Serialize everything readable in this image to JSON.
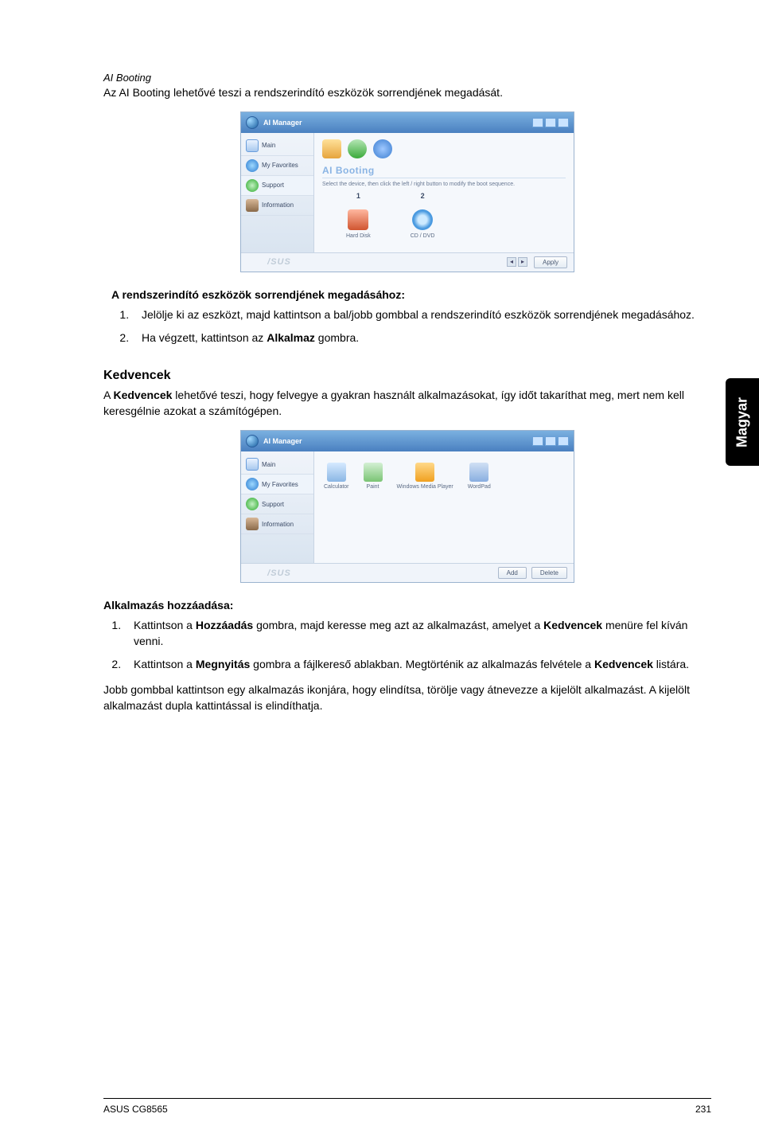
{
  "sidebar_lang": "Magyar",
  "ai_booting": {
    "heading": "AI Booting",
    "intro": "Az AI Booting lehetővé teszi a rendszerindító eszközök sorrendjének megadását."
  },
  "screenshot1": {
    "window_title": "AI Manager",
    "side": {
      "main": "Main",
      "fav": "My Favorites",
      "support": "Support",
      "info": "Information"
    },
    "sub_heading": "AI Booting",
    "hint": "Select the device, then click the left / right button to modify the boot sequence.",
    "col1_num": "1",
    "col1_label": "Hard Disk",
    "col2_num": "2",
    "col2_label": "CD / DVD",
    "apply_btn": "Apply",
    "logo": "/SUS"
  },
  "steps1": {
    "title": "A rendszerindító eszközök sorrendjének megadásához:",
    "s1": "Jelölje ki az eszközt, majd kattintson a bal/jobb gombbal a rendszerindító eszközök sorrendjének megadásához.",
    "s2_pre": "Ha végzett, kattintson az ",
    "s2_bold": "Alkalmaz",
    "s2_post": " gombra."
  },
  "kedvencek": {
    "heading": "Kedvencek",
    "para_pre": "A ",
    "para_bold": "Kedvencek",
    "para_post": " lehetővé teszi, hogy felvegye a gyakran használt alkalmazásokat, így időt takaríthat meg, mert nem kell keresgélnie azokat a számítógépen."
  },
  "screenshot2": {
    "window_title": "AI Manager",
    "side": {
      "main": "Main",
      "fav": "My Favorites",
      "support": "Support",
      "info": "Information"
    },
    "apps": {
      "a1": "Calculator",
      "a2": "Paint",
      "a3": "Windows Media Player",
      "a4": "WordPad"
    },
    "btn_add": "Add",
    "btn_delete": "Delete",
    "logo": "/SUS"
  },
  "steps2": {
    "title": "Alkalmazás hozzáadása:",
    "s1_a": "Kattintson a ",
    "s1_b": "Hozzáadás",
    "s1_c": " gombra, majd keresse meg azt az alkalmazást, amelyet a ",
    "s1_d": "Kedvencek",
    "s1_e": " menüre fel kíván venni.",
    "s2_a": "Kattintson a ",
    "s2_b": "Megnyitás",
    "s2_c": " gombra a fájlkereső ablakban. Megtörténik az alkalmazás felvétele a ",
    "s2_d": "Kedvencek",
    "s2_e": " listára."
  },
  "closing": "Jobb gombbal kattintson egy alkalmazás ikonjára, hogy elindítsa, törölje vagy átnevezze a kijelölt alkalmazást. A kijelölt alkalmazást dupla kattintással is elindíthatja.",
  "footer": {
    "left": "ASUS CG8565",
    "right": "231"
  }
}
